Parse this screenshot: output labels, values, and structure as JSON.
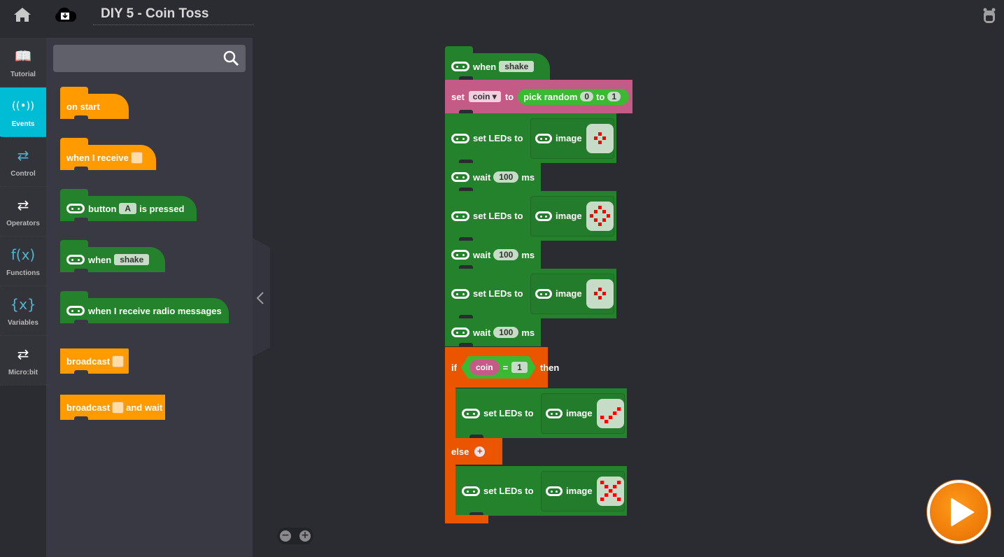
{
  "header": {
    "title": "DIY 5 - Coin Toss",
    "icons": [
      "home-icon",
      "cloud-download-icon",
      "backpack-icon"
    ]
  },
  "categories": [
    {
      "label": "Tutorial",
      "icon": "book-icon",
      "glyph": "📖",
      "active": false
    },
    {
      "label": "Events",
      "icon": "broadcast-icon",
      "glyph": "((•))",
      "active": true
    },
    {
      "label": "Control",
      "icon": "loop-icon",
      "glyph": "⇄",
      "active": false
    },
    {
      "label": "Operators",
      "icon": "loop-icon",
      "glyph": "⇄",
      "active": false
    },
    {
      "label": "Functions",
      "icon": "function-icon",
      "glyph": "f(x)",
      "active": false
    },
    {
      "label": "Variables",
      "icon": "variable-icon",
      "glyph": "{x}",
      "active": false
    },
    {
      "label": "Micro:bit",
      "icon": "loop-icon",
      "glyph": "⇄",
      "active": false
    }
  ],
  "search": {
    "placeholder": "",
    "value": ""
  },
  "palette": {
    "on_start": "on start",
    "when_receive": "when I receive",
    "button": {
      "pre": "button",
      "value": "A",
      "post": "is pressed"
    },
    "when_shake": {
      "pre": "when",
      "value": "shake"
    },
    "radio": "when I receive radio messages",
    "broadcast": "broadcast",
    "broadcast_wait": {
      "pre": "broadcast",
      "post": "and wait"
    }
  },
  "script": {
    "hat": {
      "pre": "when",
      "value": "shake"
    },
    "set_var": {
      "set": "set",
      "var": "coin",
      "to": "to",
      "pick": "pick random",
      "from": "0",
      "to2": "to",
      "max": "1"
    },
    "set_leds": "set LEDs to",
    "image": "image",
    "wait": {
      "label": "wait",
      "value": "100",
      "unit": "ms"
    },
    "if": {
      "if": "if",
      "var": "coin",
      "op": "=",
      "value": "1",
      "then": "then",
      "else": "else"
    },
    "led_patterns": {
      "small_diamond": [
        [
          1,
          2
        ],
        [
          2,
          1
        ],
        [
          2,
          3
        ],
        [
          3,
          2
        ]
      ],
      "big_diamond": [
        [
          0,
          2
        ],
        [
          1,
          1
        ],
        [
          1,
          3
        ],
        [
          2,
          0
        ],
        [
          2,
          4
        ],
        [
          3,
          1
        ],
        [
          3,
          3
        ],
        [
          4,
          2
        ]
      ],
      "check": [
        [
          1,
          4
        ],
        [
          2,
          3
        ],
        [
          3,
          0
        ],
        [
          3,
          2
        ],
        [
          4,
          1
        ]
      ],
      "cross": [
        [
          0,
          0
        ],
        [
          0,
          4
        ],
        [
          1,
          1
        ],
        [
          1,
          3
        ],
        [
          2,
          2
        ],
        [
          3,
          1
        ],
        [
          3,
          3
        ],
        [
          4,
          0
        ],
        [
          4,
          4
        ]
      ]
    }
  },
  "zoom_controls": {
    "minus": "−",
    "plus": "+"
  },
  "colors": {
    "events_accent": "#00bcd4",
    "events_block": "#ff9b00",
    "microbit_block": "#24822c",
    "variable_block": "#c45b86",
    "control_block": "#eb5500",
    "run_button": "#ff8a00"
  }
}
